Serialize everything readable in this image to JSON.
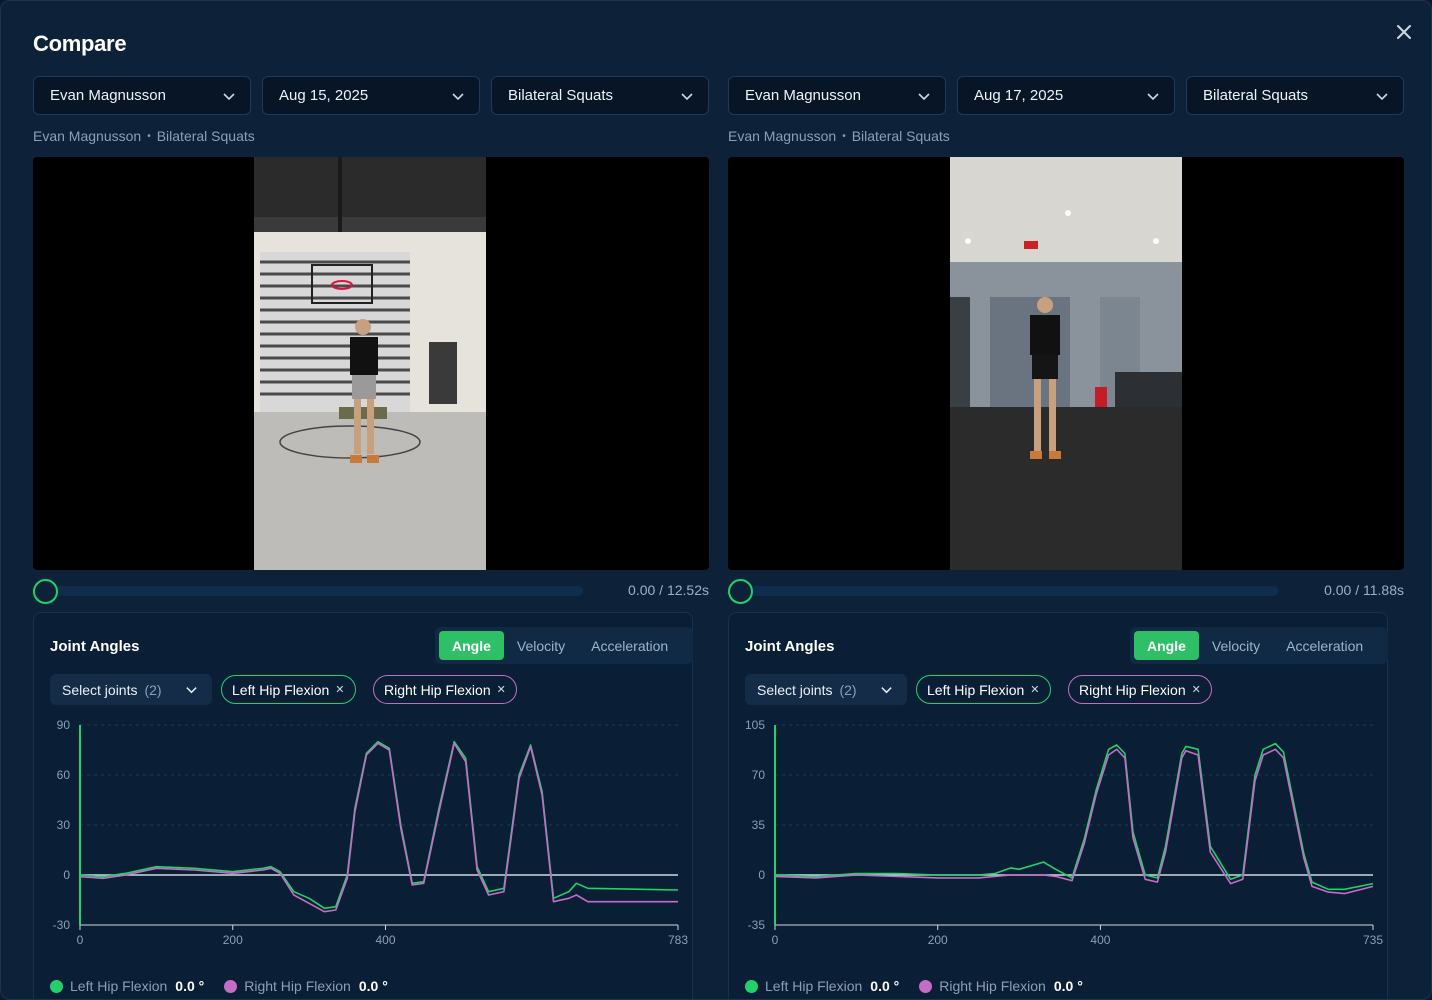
{
  "modal": {
    "title": "Compare",
    "close_icon": "close-icon"
  },
  "colors": {
    "accent": "#22d16a",
    "left_series": "#22d16a",
    "right_series": "#c56cc6",
    "background": "#0d2238"
  },
  "panels": [
    {
      "person": "Evan Magnusson",
      "date": "Aug 15, 2025",
      "exercise": "Bilateral Squats",
      "subtitle_name": "Evan Magnusson",
      "subtitle_exercise": "Bilateral Squats",
      "video": {
        "progress": 0,
        "time": "0.00 / 12.52s",
        "scene": "basketball gym"
      },
      "card": {
        "title": "Joint Angles",
        "tabs": [
          "Angle",
          "Velocity",
          "Acceleration"
        ],
        "active_tab": "Angle",
        "select_label": "Select joints",
        "select_count": "(2)",
        "chips": [
          "Left Hip Flexion",
          "Right Hip Flexion"
        ],
        "legend": [
          {
            "name": "Left Hip Flexion",
            "value": "0.0 °"
          },
          {
            "name": "Right Hip Flexion",
            "value": "0.0 °"
          }
        ]
      },
      "chart_data": {
        "type": "line",
        "xlim": [
          0,
          783
        ],
        "ylim": [
          -30,
          90
        ],
        "xticks": [
          "0",
          "200",
          "400",
          "783"
        ],
        "yticks": [
          "90",
          "60",
          "30",
          "0",
          "-30"
        ],
        "ytick_values": [
          90,
          60,
          30,
          0,
          -30
        ],
        "xtick_values": [
          0,
          200,
          400,
          783
        ],
        "series": [
          {
            "name": "Left Hip Flexion",
            "color": "#22d16a",
            "x": [
              0,
              30,
              60,
              100,
              150,
              200,
              240,
              250,
              262,
              280,
              300,
              320,
              335,
              350,
              360,
              375,
              390,
              405,
              420,
              435,
              450,
              470,
              490,
              505,
              520,
              535,
              555,
              575,
              590,
              605,
              620,
              640,
              650,
              665,
              783
            ],
            "y": [
              0,
              -1,
              1,
              5,
              4,
              2,
              4,
              5,
              2,
              -10,
              -14,
              -20,
              -19,
              0,
              40,
              73,
              80,
              76,
              30,
              -5,
              -4,
              40,
              80,
              70,
              5,
              -10,
              -8,
              60,
              78,
              50,
              -14,
              -10,
              -5,
              -8,
              -9
            ]
          },
          {
            "name": "Right Hip Flexion",
            "color": "#c56cc6",
            "x": [
              0,
              30,
              60,
              100,
              150,
              200,
              240,
              250,
              262,
              280,
              300,
              320,
              335,
              350,
              360,
              375,
              390,
              405,
              420,
              435,
              450,
              470,
              490,
              505,
              520,
              535,
              555,
              575,
              590,
              605,
              620,
              640,
              650,
              665,
              783
            ],
            "y": [
              -1,
              -2,
              0,
              4,
              3,
              1,
              3,
              4,
              1,
              -12,
              -17,
              -22,
              -21,
              -2,
              38,
              72,
              79,
              75,
              28,
              -6,
              -5,
              38,
              79,
              68,
              3,
              -12,
              -10,
              58,
              77,
              48,
              -16,
              -14,
              -12,
              -16,
              -16
            ]
          }
        ]
      }
    },
    {
      "person": "Evan Magnusson",
      "date": "Aug 17, 2025",
      "exercise": "Bilateral Squats",
      "subtitle_name": "Evan Magnusson",
      "subtitle_exercise": "Bilateral Squats",
      "video": {
        "progress": 0,
        "time": "0.00 / 11.88s",
        "scene": "office room"
      },
      "card": {
        "title": "Joint Angles",
        "tabs": [
          "Angle",
          "Velocity",
          "Acceleration"
        ],
        "active_tab": "Angle",
        "select_label": "Select joints",
        "select_count": "(2)",
        "chips": [
          "Left Hip Flexion",
          "Right Hip Flexion"
        ],
        "legend": [
          {
            "name": "Left Hip Flexion",
            "value": "0.0 °"
          },
          {
            "name": "Right Hip Flexion",
            "value": "0.0 °"
          }
        ]
      },
      "chart_data": {
        "type": "line",
        "xlim": [
          0,
          735
        ],
        "ylim": [
          -35,
          105
        ],
        "xticks": [
          "0",
          "200",
          "400",
          "735"
        ],
        "yticks": [
          "105",
          "70",
          "35",
          "0",
          "-35"
        ],
        "ytick_values": [
          105,
          70,
          35,
          0,
          -35
        ],
        "xtick_values": [
          0,
          200,
          400,
          735
        ],
        "series": [
          {
            "name": "Left Hip Flexion",
            "color": "#22d16a",
            "x": [
              0,
              50,
              100,
              150,
              200,
              250,
              270,
              290,
              300,
              330,
              345,
              365,
              380,
              395,
              410,
              420,
              430,
              440,
              455,
              470,
              480,
              500,
              505,
              520,
              535,
              560,
              575,
              590,
              600,
              615,
              625,
              650,
              660,
              680,
              700,
              735
            ],
            "y": [
              0,
              -1,
              1,
              1,
              0,
              0,
              1,
              5,
              4,
              9,
              4,
              -2,
              25,
              60,
              88,
              91,
              85,
              30,
              0,
              -2,
              20,
              85,
              90,
              88,
              20,
              -3,
              0,
              70,
              88,
              92,
              86,
              15,
              -5,
              -10,
              -10,
              -6
            ]
          },
          {
            "name": "Right Hip Flexion",
            "color": "#c56cc6",
            "x": [
              0,
              50,
              100,
              150,
              200,
              250,
              270,
              290,
              300,
              330,
              345,
              365,
              380,
              395,
              410,
              420,
              430,
              440,
              455,
              470,
              480,
              500,
              505,
              520,
              535,
              560,
              575,
              590,
              600,
              615,
              625,
              650,
              660,
              680,
              700,
              735
            ],
            "y": [
              -1,
              -2,
              0,
              -1,
              -2,
              -2,
              -1,
              0,
              0,
              0,
              -1,
              -4,
              22,
              57,
              84,
              88,
              82,
              26,
              -3,
              -5,
              16,
              82,
              87,
              84,
              16,
              -6,
              -3,
              66,
              84,
              88,
              82,
              12,
              -8,
              -12,
              -13,
              -8
            ]
          }
        ]
      }
    }
  ]
}
